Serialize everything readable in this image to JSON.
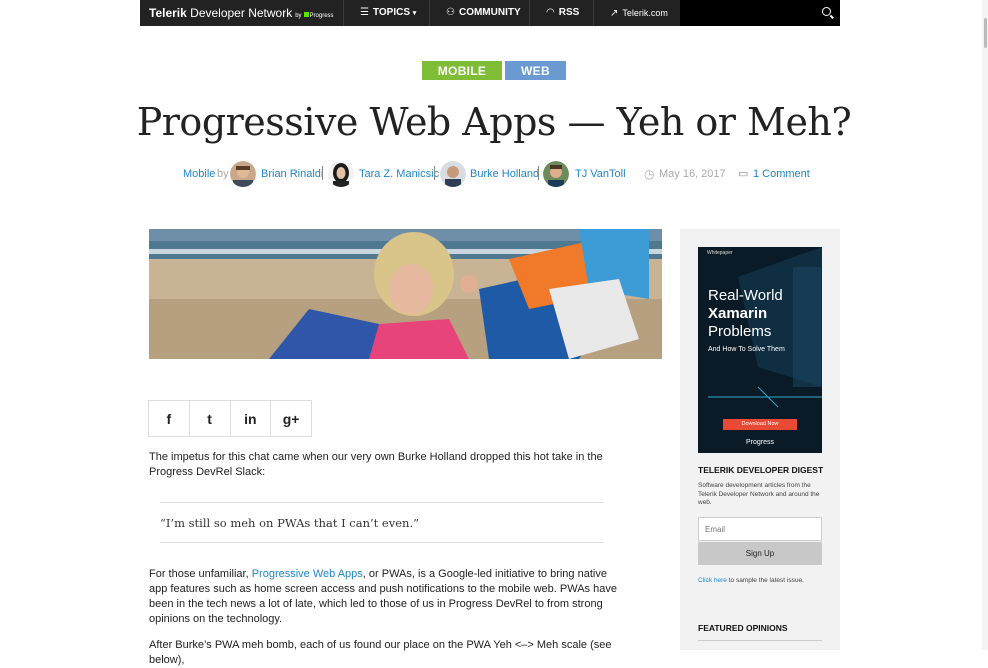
{
  "nav": {
    "brand_bold": "Telerik",
    "brand_rest": "Developer Network",
    "brand_by": "by",
    "brand_progress": "Progress",
    "topics": "TOPICS",
    "community": "COMMUNITY",
    "rss": "RSS",
    "telerik": "Telerik.com"
  },
  "tags": [
    "MOBILE",
    "WEB"
  ],
  "article": {
    "title": "Progressive Web Apps — Yeh or Meh?",
    "category": "Mobile",
    "by": "by",
    "authors": [
      "Brian Rinaldi",
      "Tara Z. Manicsic",
      "Burke Holland",
      "TJ VanToll"
    ],
    "date": "May 16, 2017",
    "comments": "1 Comment",
    "p1": "The impetus for this chat came when our very own Burke Holland dropped this hot take in the Progress DevRel Slack:",
    "quote": "“I’m still so meh on PWAs that I can’t even.”",
    "p2_before": "For those unfamiliar, ",
    "p2_link": "Progressive Web Apps",
    "p2_after": ", or PWAs, is a Google-led initiative to bring native app features such as home screen access and push notifications to the mobile web. PWAs have been in the tech news a lot of late, which led to those of us in Progress DevRel to from strong opinions on the technology.",
    "p3": "After Burke’s PWA meh bomb, each of us found our place on the PWA Yeh <–> Meh scale (see below),"
  },
  "share": [
    "f",
    "t",
    "in",
    "g+"
  ],
  "sidebar": {
    "ad": {
      "label": "Whitepaper",
      "line1": "Real-World",
      "line2": "Xamarin",
      "line3": "Problems",
      "sub": "And How To Solve Them",
      "button": "Download Now",
      "logo": "Progress"
    },
    "digest_title": "TELERIK DEVELOPER DIGEST",
    "digest_desc": "Software development articles from the Telerik Developer Network and around the web.",
    "email_placeholder": "Email",
    "signup": "Sign Up",
    "sample_link": "Click here",
    "sample_rest": " to sample the latest issue.",
    "featured": "FEATURED OPINIONS"
  },
  "colors": {
    "mobile_tag": "#7ebd34",
    "web_tag": "#6b9ad3",
    "link": "#1f86c8",
    "nav_bg": "#222222"
  }
}
